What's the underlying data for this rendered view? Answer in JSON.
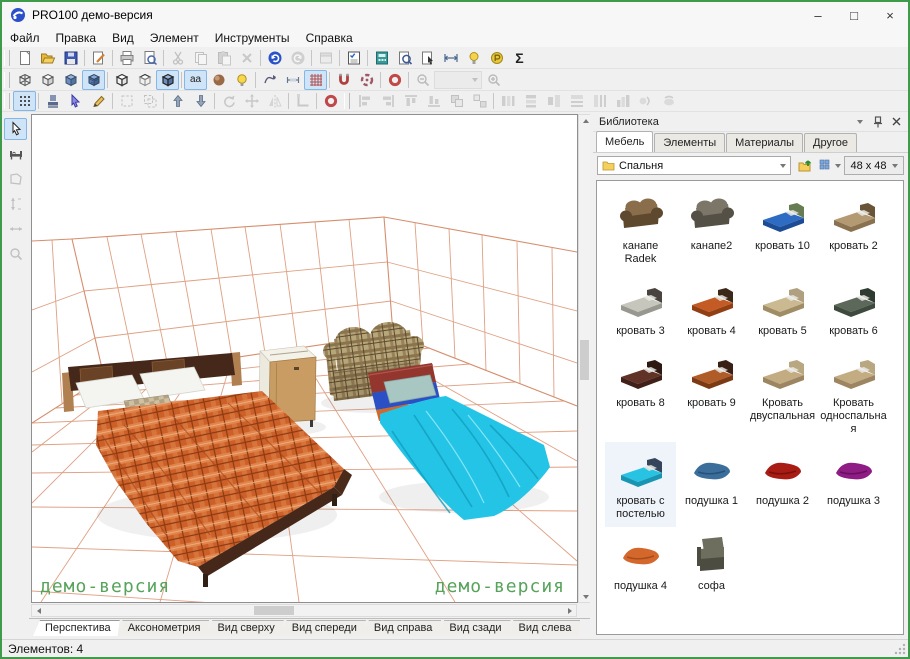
{
  "window": {
    "title": "PRO100 демо-версия",
    "controls": {
      "minimize": "–",
      "maximize": "□",
      "close": "×"
    }
  },
  "menu": {
    "items": [
      "Файл",
      "Правка",
      "Вид",
      "Элемент",
      "Инструменты",
      "Справка"
    ]
  },
  "toolbar1": {
    "icons": [
      "new-document",
      "open",
      "save",
      "properties",
      "print",
      "print-preview",
      "cut",
      "copy",
      "paste",
      "delete",
      "undo",
      "redo",
      "window",
      "options-checklist",
      "report",
      "zoom-document",
      "select-document",
      "dimensions",
      "light-document",
      "price-document",
      "sum"
    ],
    "sum_glyph": "Σ"
  },
  "toolbar2": {
    "icons": [
      "wireframe-view",
      "white-view",
      "color-view",
      "textured-view",
      "contour-white",
      "contour-wire",
      "contour-color",
      "text-labels",
      "shading",
      "lighting",
      "texture-flow",
      "dimension-lines",
      "grid",
      "magnet-snap",
      "snap-center",
      "snap-ring",
      "zoom-out",
      "zoom-value",
      "zoom-in"
    ],
    "labels_glyph": "aa",
    "zoom_value": ""
  },
  "toolbar3": {
    "icons": [
      "dot-grid",
      "stamp",
      "select-cursor",
      "draw-pencil",
      "select-area",
      "select-group",
      "raise",
      "lower",
      "rotate",
      "move",
      "mirror",
      "corner",
      "snap-ring",
      "align-left",
      "align-right",
      "align-top",
      "align-bottom",
      "group",
      "ungroup",
      "distribute-1",
      "distribute-2",
      "distribute-3",
      "distribute-4",
      "distribute-5",
      "distribute-6",
      "distribute-7",
      "distribute-8"
    ]
  },
  "left_toolbar": {
    "icons": [
      "pointer",
      "furniture-tool",
      "contour-tool",
      "vertical-dimension",
      "horizontal-dimension",
      "zoom-tool"
    ]
  },
  "viewport": {
    "watermark": "демо-версия"
  },
  "view_tabs": [
    {
      "label": "Перспектива",
      "active": true
    },
    {
      "label": "Аксонометрия",
      "active": false
    },
    {
      "label": "Вид сверху",
      "active": false
    },
    {
      "label": "Вид спереди",
      "active": false
    },
    {
      "label": "Вид справа",
      "active": false
    },
    {
      "label": "Вид сзади",
      "active": false
    },
    {
      "label": "Вид слева",
      "active": false
    }
  ],
  "library": {
    "title": "Библиотека",
    "header_icons": [
      "menu-down",
      "pin",
      "close"
    ],
    "tabs": [
      {
        "label": "Мебель",
        "active": true
      },
      {
        "label": "Элементы",
        "active": false
      },
      {
        "label": "Материалы",
        "active": false
      },
      {
        "label": "Другое",
        "active": false
      }
    ],
    "folder": "Спальня",
    "thumb_size": "48 x 48",
    "items": [
      {
        "label": "канапе Radek",
        "icon": "sofa-brown",
        "selected": false
      },
      {
        "label": "канапе2",
        "icon": "sofa-gray",
        "selected": false
      },
      {
        "label": "кровать 10",
        "icon": "bed-blue",
        "selected": false
      },
      {
        "label": "кровать 2",
        "icon": "bed-tan",
        "selected": false
      },
      {
        "label": "кровать 3",
        "icon": "bed-light",
        "selected": false
      },
      {
        "label": "кровать 4",
        "icon": "bed-orange",
        "selected": false
      },
      {
        "label": "кровать 5",
        "icon": "bed-beige",
        "selected": false
      },
      {
        "label": "кровать 6",
        "icon": "bed-green",
        "selected": false
      },
      {
        "label": "кровать 8",
        "icon": "bed-darkbrown",
        "selected": false
      },
      {
        "label": "кровать 9",
        "icon": "bed-redbrown",
        "selected": false
      },
      {
        "label": "Кровать двуспальная",
        "icon": "bed-wood",
        "selected": false
      },
      {
        "label": "Кровать односпальная",
        "icon": "bed-wood",
        "selected": false
      },
      {
        "label": "кровать с постелью",
        "icon": "bed-cyan",
        "selected": true
      },
      {
        "label": "подушка 1",
        "icon": "pillow-blue",
        "selected": false
      },
      {
        "label": "подушка 2",
        "icon": "pillow-red",
        "selected": false
      },
      {
        "label": "подушка 3",
        "icon": "pillow-purple",
        "selected": false
      },
      {
        "label": "подушка 4",
        "icon": "pillow-orange",
        "selected": false
      },
      {
        "label": "софа",
        "icon": "armchair-gray",
        "selected": false
      }
    ]
  },
  "status": {
    "text": "Элементов: 4"
  },
  "colors": {
    "window_border": "#3f9b4a",
    "watermark": "#57a35c",
    "room_grid": "#e09f82",
    "pressed_button": "#cfe4f7"
  }
}
